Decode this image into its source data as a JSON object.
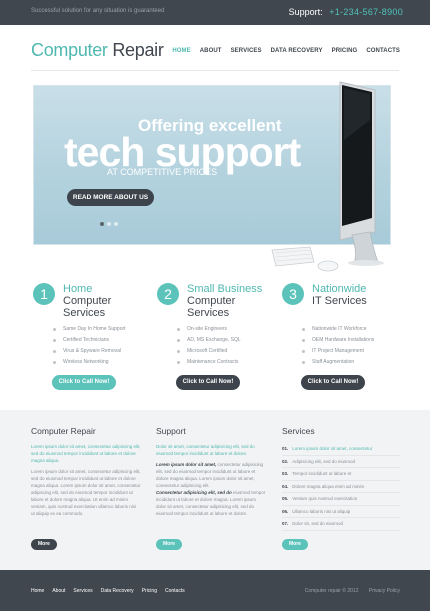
{
  "topbar": {
    "tagline": "Successful solution for any situation is guaranteed",
    "support_label": "Support:",
    "phone": "+1-234-567-8900"
  },
  "header": {
    "logo_part1": "Computer",
    "logo_part2": "Repair",
    "nav": [
      "HOME",
      "ABOUT",
      "SERVICES",
      "DATA RECOVERY",
      "PRICING",
      "CONTACTS"
    ],
    "active_nav": "HOME"
  },
  "slider": {
    "small_heading": "Offering excellent",
    "big_heading": "tech support",
    "sub_heading": "AT COMPETITIVE PRICES",
    "button_label": "READ MORE ABOUT US",
    "slide_count": 3,
    "active_slide": 1
  },
  "features": [
    {
      "number": "1",
      "title_line1": "Home",
      "title_line2": "Computer",
      "title_line3": "Services",
      "items": [
        "Same Day In Home Support",
        "Certified Technicians",
        "Virus & Spyware Removal",
        "Wireless Networking"
      ],
      "button_label": "Click to Call Now!",
      "button_style": "teal"
    },
    {
      "number": "2",
      "title_line1": "Small Business",
      "title_line2": "Computer",
      "title_line3": "Services",
      "items": [
        "On-site Engineers",
        "AD, MS Exchange, SQL",
        "Microsoft Certified",
        "Maintenance Contracts"
      ],
      "button_label": "Click to Call Now!",
      "button_style": "dark"
    },
    {
      "number": "3",
      "title_line1": "Nationwide",
      "title_line2": "IT Services",
      "title_line3": "",
      "items": [
        "Nationwide IT Workforce",
        "OEM Hardware Installations",
        "IT Project Management",
        "Staff Augmentation"
      ],
      "button_label": "Click to Call Now!",
      "button_style": "dark"
    }
  ],
  "info": {
    "col1": {
      "heading": "Computer Repair",
      "intro": "Lorem ipsum dolor sit amet, consectetur adipiscing elit, sed do eiusmod tempor incididunt ut labore et dolore magna aliqua.",
      "body": "Lorem ipsum dolor sit amet, consectetur adipiscing elit, sed do eiusmod tempor incididunt ut labore et dolore magna aliqua. Lorem ipsum dolor sit amet, consectetur adipiscing elit, sed do eiusmod tempor incididunt ut labore et dolore magna aliqua. Ut enim ad minim veniam, quis nostrud exercitation ullamco laboris nisi ut aliquip ex ea commodo.",
      "more": "More"
    },
    "col2": {
      "heading": "Support",
      "intro": "Dolor sit amet, consectetur adipisicing elit, sed do eiusmod tempor incididunt ut labore et dolore.",
      "bold1": "Lorem ipsum dolor sit amet,",
      "body1": " consectetur adipisicing elit, sed do eiusmod tempor incididunt ut labore et dolore magna aliqua. Lorem ipsum dolor sit amet, consectetur adipisicing elit.",
      "bold2": "Consectetur adipisicing elit, sed do",
      "body2": " eiusmod tempor incididunt ut labore et dolore magna. Lorem ipsum dolor sit amet, consectetur adipisicing elit, sed do eiusmod tempor incididunt ut labore et dolore.",
      "more": "More"
    },
    "col3": {
      "heading": "Services",
      "items": [
        {
          "n": "01.",
          "text": "Lorem ipsum dolor sit amet, consectetur",
          "highlight": true
        },
        {
          "n": "02.",
          "text": "Adipisicing elit, sed do eiusmod",
          "highlight": false
        },
        {
          "n": "03.",
          "text": "Tempor incididunt ut labore et",
          "highlight": false
        },
        {
          "n": "04.",
          "text": "Dolore magna aliqua enim ad minim",
          "highlight": false
        },
        {
          "n": "05.",
          "text": "Veniam quis nostrud exercitation",
          "highlight": false
        },
        {
          "n": "06.",
          "text": "Ullamco laboris nisi ut aliquip",
          "highlight": false
        },
        {
          "n": "07.",
          "text": "Dolor sit, sed do eiusmod",
          "highlight": false
        }
      ],
      "more": "More"
    }
  },
  "footer": {
    "nav": [
      "Home",
      "About",
      "Services",
      "Data Recovery",
      "Pricing",
      "Contacts"
    ],
    "copyright": "Computer repair © 2012",
    "privacy": "Privacy Policy"
  },
  "colors": {
    "accent": "#4fb8b0",
    "dark": "#41474f",
    "band": "#f2f3f4"
  }
}
